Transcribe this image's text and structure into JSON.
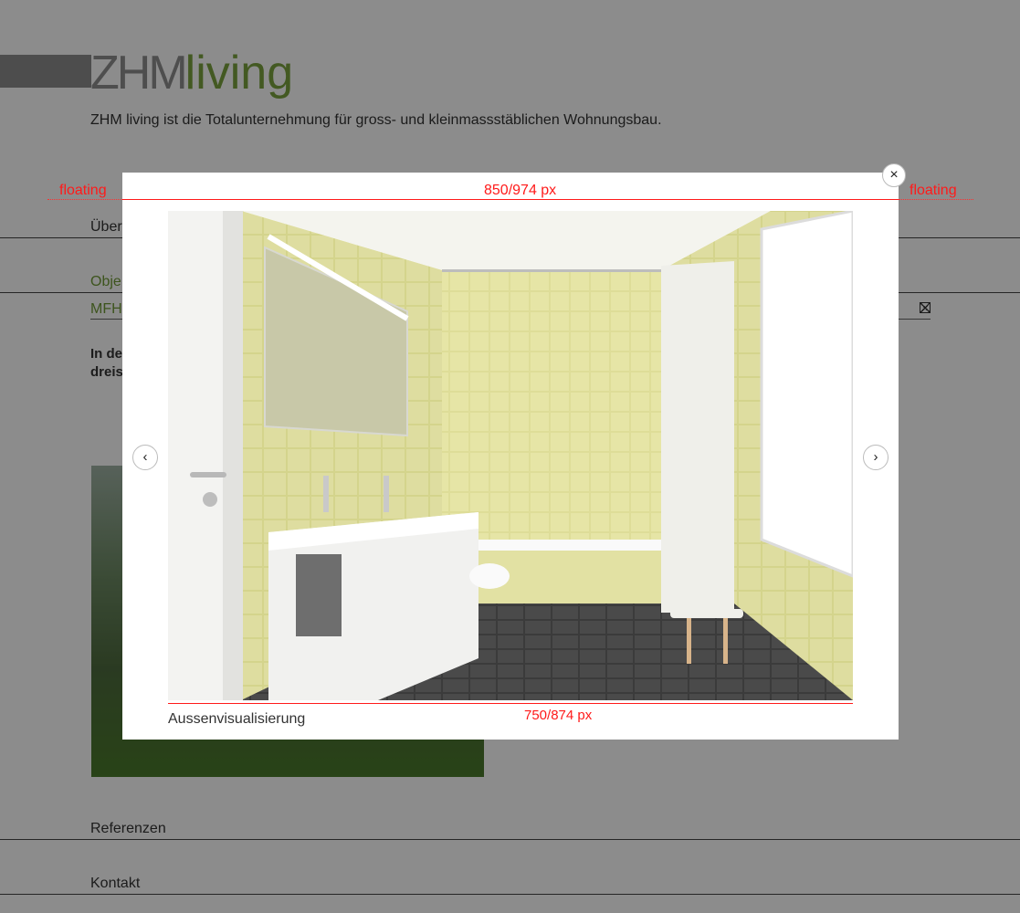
{
  "brand": {
    "logo_left": "ZHM",
    "logo_right": "living"
  },
  "tagline": "ZHM living ist die Totalunternehmung für gross- und kleinmassstäblichen Wohnungsbau.",
  "nav": {
    "ueber": "Über",
    "objekte": "Obje",
    "mfh": "MFH",
    "referenzen": "Referenzen",
    "kontakt": "Kontakt"
  },
  "body_text": {
    "line1": "In de",
    "line2": "dreis"
  },
  "annotations": {
    "outer_width": "850/974 px",
    "floating_left": "floating",
    "floating_right": "floating",
    "inner_width": "750/874 px"
  },
  "lightbox": {
    "caption": "Aussenvisualisierung",
    "close_symbol": "×",
    "prev_symbol": "‹",
    "next_symbol": "›"
  },
  "colors": {
    "brand_green": "#7aa33e",
    "annotation_red": "#ff1a1a",
    "tile_yellow": "#e4e3a0"
  },
  "icons": [
    "close-icon",
    "chevron-left-icon",
    "chevron-right-icon",
    "remove-filter-icon"
  ]
}
